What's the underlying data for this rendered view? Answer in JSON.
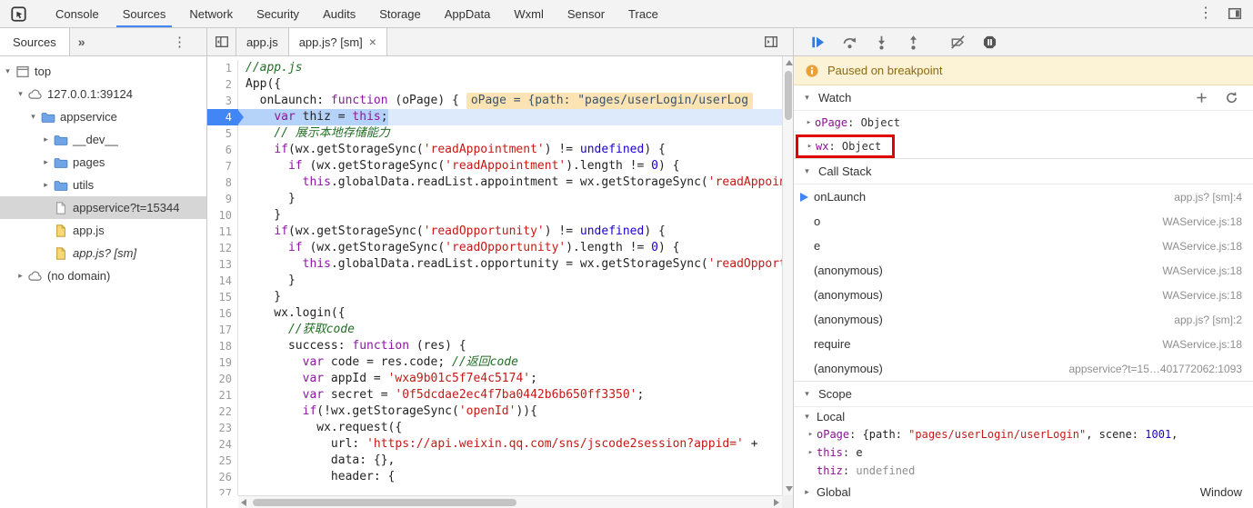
{
  "colors": {
    "accent": "#4285f4",
    "annotation": "#e00000",
    "paused-bg": "#fcf3d6",
    "paused-border": "#eadcab",
    "paused-text": "#8a6a14",
    "selection": "#d6d6d6"
  },
  "topbar": {
    "menu_glyph": "⋮",
    "tabs": [
      {
        "label": "Console"
      },
      {
        "label": "Sources",
        "active": true
      },
      {
        "label": "Network"
      },
      {
        "label": "Security"
      },
      {
        "label": "Audits"
      },
      {
        "label": "Storage"
      },
      {
        "label": "AppData"
      },
      {
        "label": "Wxml"
      },
      {
        "label": "Sensor"
      },
      {
        "label": "Trace"
      }
    ]
  },
  "sidebar": {
    "header": {
      "title": "Sources",
      "overflow_chevron": "»",
      "menu_glyph": "⋮"
    },
    "tree": [
      {
        "label": "top",
        "icon": "frame-icon",
        "arrow": "▾",
        "depth": 0
      },
      {
        "label": "127.0.0.1:39124",
        "icon": "cloud-icon",
        "arrow": "▾",
        "depth": 1
      },
      {
        "label": "appservice",
        "icon": "folder-icon",
        "arrow": "▾",
        "depth": 2
      },
      {
        "label": "__dev__",
        "icon": "folder-icon",
        "arrow": "▸",
        "depth": 3
      },
      {
        "label": "pages",
        "icon": "folder-icon",
        "arrow": "▸",
        "depth": 3
      },
      {
        "label": "utils",
        "icon": "folder-icon",
        "arrow": "▸",
        "depth": 3
      },
      {
        "label": "appservice?t=15344",
        "icon": "file-icon",
        "arrow": "",
        "depth": 3,
        "selected": true
      },
      {
        "label": "app.js",
        "icon": "js-file-icon",
        "arrow": "",
        "depth": 3
      },
      {
        "label": "app.js? [sm]",
        "icon": "js-file-icon",
        "arrow": "",
        "depth": 3,
        "italic": true
      },
      {
        "label": "(no domain)",
        "icon": "cloud-icon",
        "arrow": "▸",
        "depth": 1
      }
    ]
  },
  "editor": {
    "close_glyph": "×",
    "tabs": [
      {
        "label": "app.js"
      },
      {
        "label": "app.js? [sm]",
        "active": true,
        "closable": true
      }
    ],
    "lines": [
      {
        "n": 1,
        "t": [
          [
            "c",
            "//app.js"
          ]
        ]
      },
      {
        "n": 2,
        "t": [
          [
            "p",
            "App({"
          ]
        ]
      },
      {
        "n": 3,
        "t": [
          [
            "p",
            "  onLaunch: "
          ],
          [
            "k",
            "function"
          ],
          [
            "p",
            " (oPage) {"
          ]
        ],
        "widget": "oPage = {path: \"pages/userLogin/userLog"
      },
      {
        "n": 4,
        "exec": true,
        "t": [
          [
            "p",
            "    "
          ],
          [
            "k",
            "var"
          ],
          [
            "p",
            " thiz = "
          ],
          [
            "k",
            "this"
          ],
          [
            "p",
            ";"
          ]
        ]
      },
      {
        "n": 5,
        "t": [
          [
            "p",
            "    "
          ],
          [
            "c",
            "// 展示本地存储能力"
          ]
        ]
      },
      {
        "n": 6,
        "t": [
          [
            "p",
            "    "
          ],
          [
            "k",
            "if"
          ],
          [
            "p",
            "(wx.getStorageSync("
          ],
          [
            "s",
            "'readAppointment'"
          ],
          [
            "p",
            ") != "
          ],
          [
            "a",
            "undefined"
          ],
          [
            "p",
            ") {"
          ]
        ]
      },
      {
        "n": 7,
        "t": [
          [
            "p",
            "      "
          ],
          [
            "k",
            "if"
          ],
          [
            "p",
            " (wx.getStorageSync("
          ],
          [
            "s",
            "'readAppointment'"
          ],
          [
            "p",
            ").length != "
          ],
          [
            "a",
            "0"
          ],
          [
            "p",
            ") {"
          ]
        ]
      },
      {
        "n": 8,
        "t": [
          [
            "p",
            "        "
          ],
          [
            "k",
            "this"
          ],
          [
            "p",
            ".globalData.readList.appointment = wx.getStorageSync("
          ],
          [
            "s",
            "'readAppointment'"
          ],
          [
            "p",
            ");"
          ]
        ]
      },
      {
        "n": 9,
        "t": [
          [
            "p",
            "      }"
          ]
        ]
      },
      {
        "n": 10,
        "t": [
          [
            "p",
            "    }"
          ]
        ]
      },
      {
        "n": 11,
        "t": [
          [
            "p",
            "    "
          ],
          [
            "k",
            "if"
          ],
          [
            "p",
            "(wx.getStorageSync("
          ],
          [
            "s",
            "'readOpportunity'"
          ],
          [
            "p",
            ") != "
          ],
          [
            "a",
            "undefined"
          ],
          [
            "p",
            ") {"
          ]
        ]
      },
      {
        "n": 12,
        "t": [
          [
            "p",
            "      "
          ],
          [
            "k",
            "if"
          ],
          [
            "p",
            " (wx.getStorageSync("
          ],
          [
            "s",
            "'readOpportunity'"
          ],
          [
            "p",
            ").length != "
          ],
          [
            "a",
            "0"
          ],
          [
            "p",
            ") {"
          ]
        ]
      },
      {
        "n": 13,
        "t": [
          [
            "p",
            "        "
          ],
          [
            "k",
            "this"
          ],
          [
            "p",
            ".globalData.readList.opportunity = wx.getStorageSync("
          ],
          [
            "s",
            "'readOpportunity'"
          ],
          [
            "p",
            ");"
          ]
        ]
      },
      {
        "n": 14,
        "t": [
          [
            "p",
            "      }"
          ]
        ]
      },
      {
        "n": 15,
        "t": [
          [
            "p",
            "    }"
          ]
        ]
      },
      {
        "n": 16,
        "t": [
          [
            "p",
            "    wx.login({"
          ]
        ]
      },
      {
        "n": 17,
        "t": [
          [
            "p",
            "      "
          ],
          [
            "c",
            "//获取code"
          ]
        ]
      },
      {
        "n": 18,
        "t": [
          [
            "p",
            "      success: "
          ],
          [
            "k",
            "function"
          ],
          [
            "p",
            " (res) {"
          ]
        ]
      },
      {
        "n": 19,
        "t": [
          [
            "p",
            "        "
          ],
          [
            "k",
            "var"
          ],
          [
            "p",
            " code = res.code; "
          ],
          [
            "c",
            "//返回code"
          ]
        ]
      },
      {
        "n": 20,
        "t": [
          [
            "p",
            "        "
          ],
          [
            "k",
            "var"
          ],
          [
            "p",
            " appId = "
          ],
          [
            "s",
            "'wxa9b01c5f7e4c5174'"
          ],
          [
            "p",
            ";"
          ]
        ]
      },
      {
        "n": 21,
        "t": [
          [
            "p",
            "        "
          ],
          [
            "k",
            "var"
          ],
          [
            "p",
            " secret = "
          ],
          [
            "s",
            "'0f5dcdae2ec4f7ba0442b6b650ff3350'"
          ],
          [
            "p",
            ";"
          ]
        ]
      },
      {
        "n": 22,
        "t": [
          [
            "p",
            "        "
          ],
          [
            "k",
            "if"
          ],
          [
            "p",
            "(!wx.getStorageSync("
          ],
          [
            "s",
            "'openId'"
          ],
          [
            "p",
            ")){"
          ]
        ]
      },
      {
        "n": 23,
        "t": [
          [
            "p",
            "          wx.request({"
          ]
        ]
      },
      {
        "n": 24,
        "t": [
          [
            "p",
            "            url: "
          ],
          [
            "s",
            "'https://api.weixin.qq.com/sns/jscode2session?appid='"
          ],
          [
            "p",
            " +"
          ]
        ]
      },
      {
        "n": 25,
        "t": [
          [
            "p",
            "            data: {},"
          ]
        ]
      },
      {
        "n": 26,
        "t": [
          [
            "p",
            "            header: {"
          ]
        ]
      },
      {
        "n": 27,
        "t": [
          [
            "p",
            ""
          ]
        ]
      }
    ]
  },
  "debugger": {
    "toolbar": [
      {
        "name": "resume-button",
        "icon": "resume-icon"
      },
      {
        "name": "step-over-button",
        "icon": "step-over-icon"
      },
      {
        "name": "step-into-button",
        "icon": "step-into-icon"
      },
      {
        "name": "step-out-button",
        "icon": "step-out-icon"
      },
      {
        "name": "deactivate-breakpoints-button",
        "icon": "deactivate-breakpoints-icon",
        "gap": true
      },
      {
        "name": "pause-on-exceptions-button",
        "icon": "pause-on-exceptions-icon"
      }
    ],
    "paused_message": "Paused on breakpoint",
    "watch": {
      "title": "Watch",
      "twisty": "▾",
      "items": [
        {
          "arrow": "▸",
          "name": "oPage",
          "value": "Object"
        },
        {
          "arrow": "▸",
          "name": "wx",
          "value": "Object",
          "annotated": true
        }
      ]
    },
    "call_stack": {
      "title": "Call Stack",
      "twisty": "▾",
      "frames": [
        {
          "fn": "onLaunch",
          "loc": "app.js? [sm]:4",
          "current": true
        },
        {
          "fn": "o",
          "loc": "WAService.js:18"
        },
        {
          "fn": "e",
          "loc": "WAService.js:18"
        },
        {
          "fn": "(anonymous)",
          "loc": "WAService.js:18"
        },
        {
          "fn": "(anonymous)",
          "loc": "WAService.js:18"
        },
        {
          "fn": "(anonymous)",
          "loc": "app.js? [sm]:2"
        },
        {
          "fn": "require",
          "loc": "WAService.js:18"
        },
        {
          "fn": "(anonymous)",
          "loc": "appservice?t=15…401772062:1093"
        }
      ]
    },
    "scope": {
      "title": "Scope",
      "twisty": "▾",
      "local": {
        "label": "Local",
        "twisty": "▾",
        "vars": [
          {
            "arrow": "▸",
            "name": "oPage",
            "tokens": [
              [
                "p",
                "{path: "
              ],
              [
                "s",
                "\"pages/userLogin/userLogin\""
              ],
              [
                "p",
                ", scene: "
              ],
              [
                "a",
                "1001"
              ],
              [
                "p",
                ","
              ]
            ]
          },
          {
            "arrow": "▸",
            "name": "this",
            "tokens": [
              [
                "p",
                "e"
              ]
            ]
          },
          {
            "arrow": "",
            "name": "thiz",
            "tokens": [
              [
                "m",
                "undefined"
              ]
            ]
          }
        ]
      },
      "global": {
        "arrow": "▸",
        "label": "Global",
        "value": "Window"
      }
    }
  }
}
